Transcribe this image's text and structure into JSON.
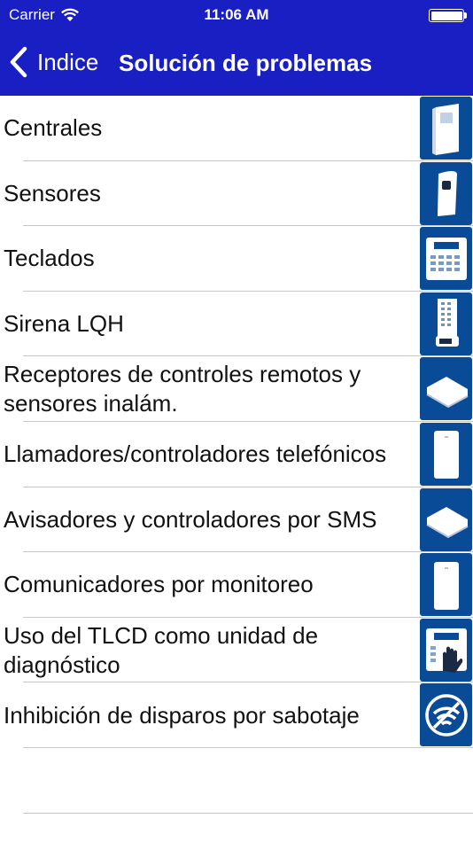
{
  "status_bar": {
    "carrier": "Carrier",
    "time": "11:06 AM",
    "icons": [
      "wifi-icon",
      "battery-icon"
    ]
  },
  "nav": {
    "back_label": "Indice",
    "title": "Solución de problemas",
    "bar_color": "#1a1fc4"
  },
  "icon_tile_color": "#0a4b97",
  "items": [
    {
      "label": "Centrales",
      "icon": "control-panel-icon"
    },
    {
      "label": "Sensores",
      "icon": "sensor-icon"
    },
    {
      "label": "Teclados",
      "icon": "keypad-icon"
    },
    {
      "label": "Sirena LQH",
      "icon": "siren-icon"
    },
    {
      "label": "Receptores de controles remotos y sensores inalám.",
      "icon": "wireless-receiver-icon"
    },
    {
      "label": "Llamadores/controladores telefónicos",
      "icon": "phone-dialer-icon"
    },
    {
      "label": "Avisadores y controladores por SMS",
      "icon": "sms-device-icon"
    },
    {
      "label": "Comunicadores por monitoreo",
      "icon": "monitoring-communicator-icon"
    },
    {
      "label": "Uso del TLCD como unidad de diagnóstico",
      "icon": "keypad-hand-icon"
    },
    {
      "label": "Inhibición de disparos por sabotaje",
      "icon": "no-wifi-icon"
    }
  ]
}
